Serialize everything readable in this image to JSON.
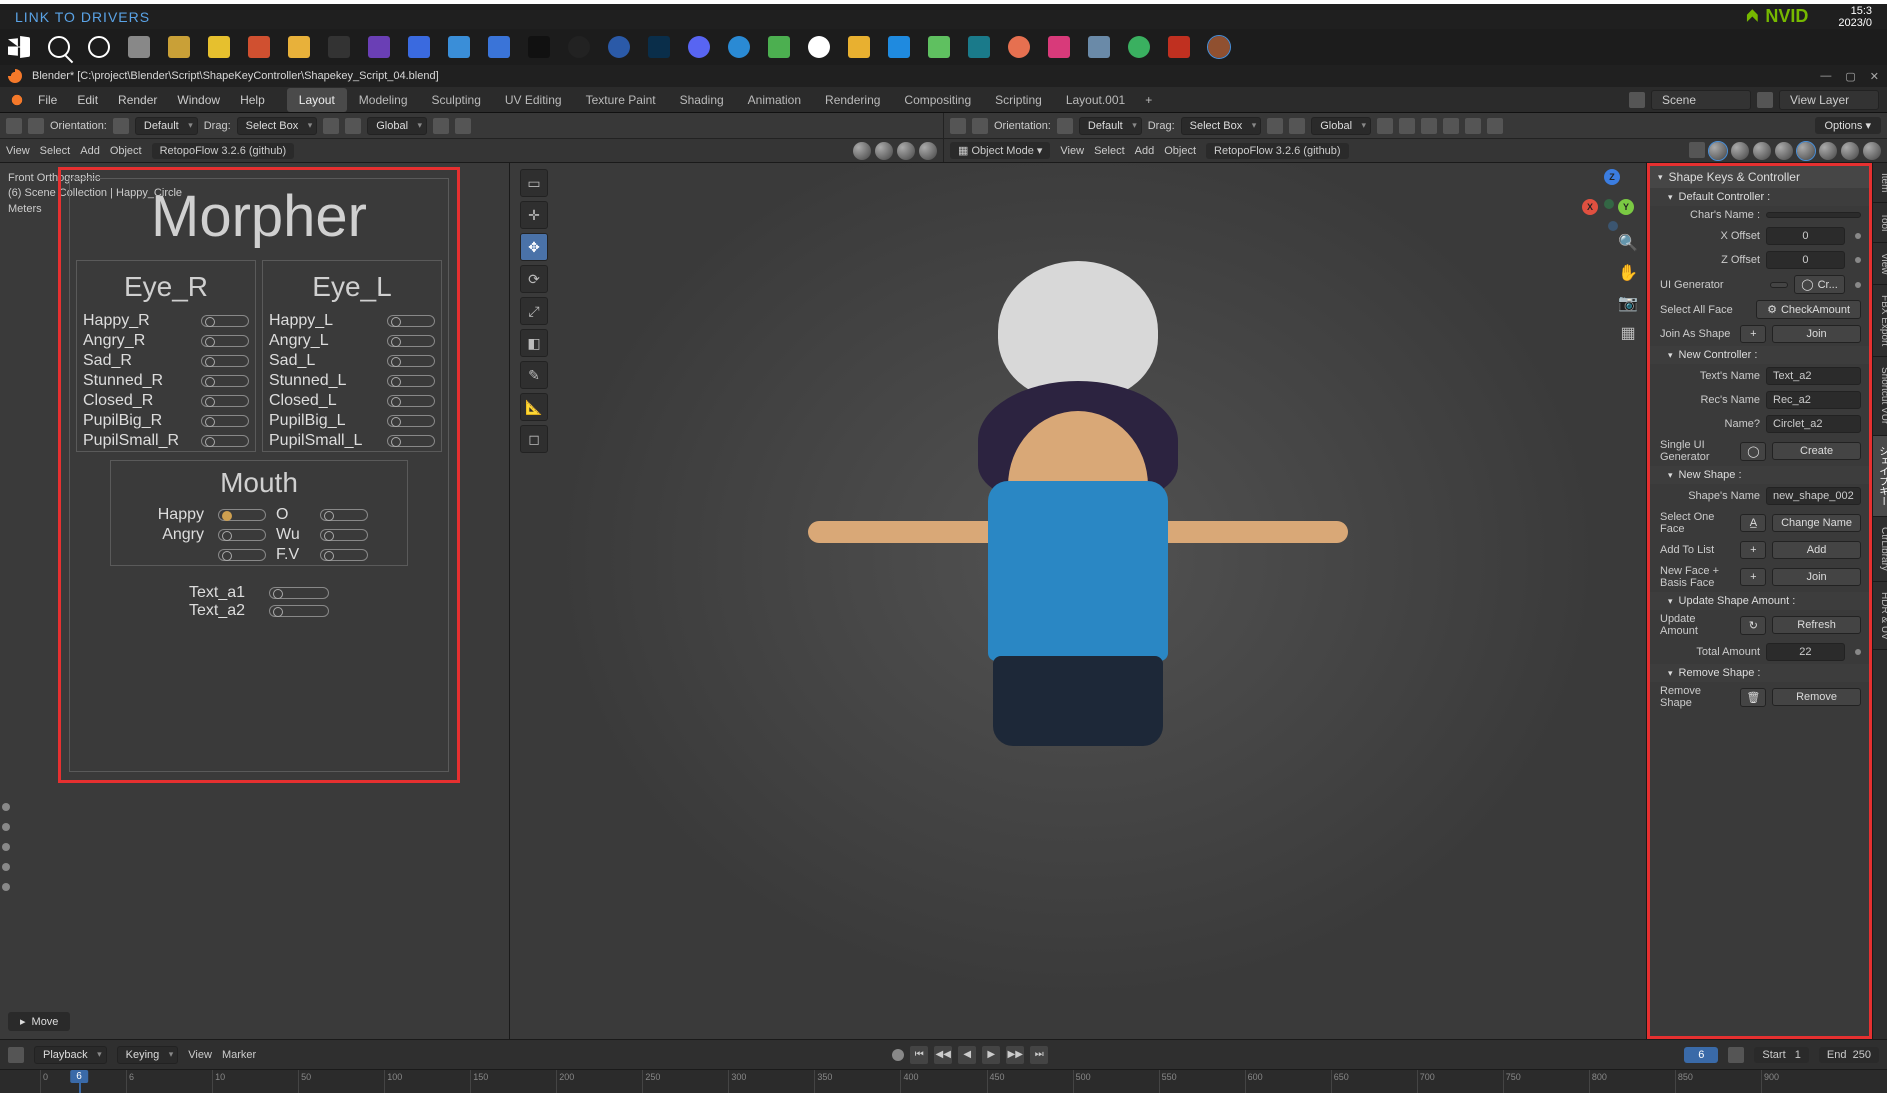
{
  "topbar": {
    "link": "LINK TO DRIVERS",
    "nvidia": "NVID",
    "clock_time": "15:3",
    "clock_date": "2023/0"
  },
  "title": "Blender* [C:\\project\\Blender\\Script\\ShapeKeyController\\Shapekey_Script_04.blend]",
  "menu": {
    "items": [
      "File",
      "Edit",
      "Render",
      "Window",
      "Help"
    ]
  },
  "workspace_tabs": [
    "Layout",
    "Modeling",
    "Sculpting",
    "UV Editing",
    "Texture Paint",
    "Shading",
    "Animation",
    "Rendering",
    "Compositing",
    "Scripting",
    "Layout.001"
  ],
  "scene": {
    "label": "Scene",
    "viewlayer": "View Layer"
  },
  "toolbar": {
    "orientation": "Orientation:",
    "default": "Default",
    "drag": "Drag:",
    "selectbox": "Select Box",
    "global": "Global",
    "options": "Options"
  },
  "toolbar2": {
    "view": "View",
    "select": "Select",
    "add": "Add",
    "object": "Object",
    "addon": "RetopoFlow 3.2.6 (github)",
    "objectmode": "Object Mode"
  },
  "hud": {
    "line1": "Front Orthographic",
    "line2": "(6) Scene Collection | Happy_Circle",
    "line3": "Meters"
  },
  "move_hint": "Move",
  "morpher": {
    "title": "Morpher",
    "eye_r": {
      "title": "Eye_R",
      "rows": [
        "Happy_R",
        "Angry_R",
        "Sad_R",
        "Stunned_R",
        "Closed_R",
        "PupilBig_R",
        "PupilSmall_R"
      ]
    },
    "eye_l": {
      "title": "Eye_L",
      "rows": [
        "Happy_L",
        "Angry_L",
        "Sad_L",
        "Stunned_L",
        "Closed_L",
        "PupilBig_L",
        "PupilSmall_L"
      ]
    },
    "mouth": {
      "title": "Mouth",
      "rows": [
        {
          "l": "Happy",
          "r": "O",
          "sel": true
        },
        {
          "l": "Angry",
          "r": "Wu",
          "sel": false
        },
        {
          "l": "",
          "r": "F.V",
          "sel": false
        }
      ]
    },
    "texts": [
      "Text_a1",
      "Text_a2"
    ]
  },
  "side_tabs": [
    "Item",
    "Tool",
    "View",
    "FBX Export",
    "Shortcut VUr",
    "シェイプキー",
    "CtrLibrary",
    "HDR & UV"
  ],
  "panel": {
    "title": "Shape Keys & Controller",
    "default_ctrl": "Default Controller :",
    "chars_name": "Char's Name :",
    "x_offset": "X Offset",
    "x_offset_v": "0",
    "z_offset": "Z Offset",
    "z_offset_v": "0",
    "ui_gen": "UI Generator",
    "ui_gen_btn": "Cr...",
    "select_all": "Select All Face",
    "check_amount": "CheckAmount",
    "join_as": "Join As Shape",
    "join": "Join",
    "new_ctrl": "New Controller :",
    "texts_name": "Text's Name",
    "texts_name_v": "Text_a2",
    "recs_name": "Rec's Name",
    "recs_name_v": "Rec_a2",
    "name_q": "Name?",
    "name_q_v": "Circlet_a2",
    "single_ui": "Single UI Generator",
    "create": "Create",
    "new_shape": "New Shape :",
    "shapes_name": "Shape's Name",
    "shapes_name_v": "new_shape_002",
    "select_one": "Select One Face",
    "change_name": "Change Name",
    "add_to_list": "Add To List",
    "add": "Add",
    "new_face": "New Face + Basis Face",
    "update_hdr": "Update Shape Amount :",
    "update_amt": "Update Amount",
    "refresh": "Refresh",
    "total_amt": "Total Amount",
    "total_amt_v": "22",
    "remove_hdr": "Remove Shape :",
    "remove_shape": "Remove Shape",
    "remove": "Remove"
  },
  "timeline": {
    "playback": "Playback",
    "keying": "Keying",
    "view": "View",
    "marker": "Marker",
    "frame": "6",
    "start_lbl": "Start",
    "start": "1",
    "end_lbl": "End",
    "end": "250",
    "ticks": [
      "0",
      "6",
      "10",
      "50",
      "100",
      "150",
      "200",
      "250",
      "300",
      "350",
      "400",
      "450",
      "500",
      "550",
      "600",
      "650",
      "700",
      "750",
      "800",
      "850",
      "900"
    ]
  }
}
